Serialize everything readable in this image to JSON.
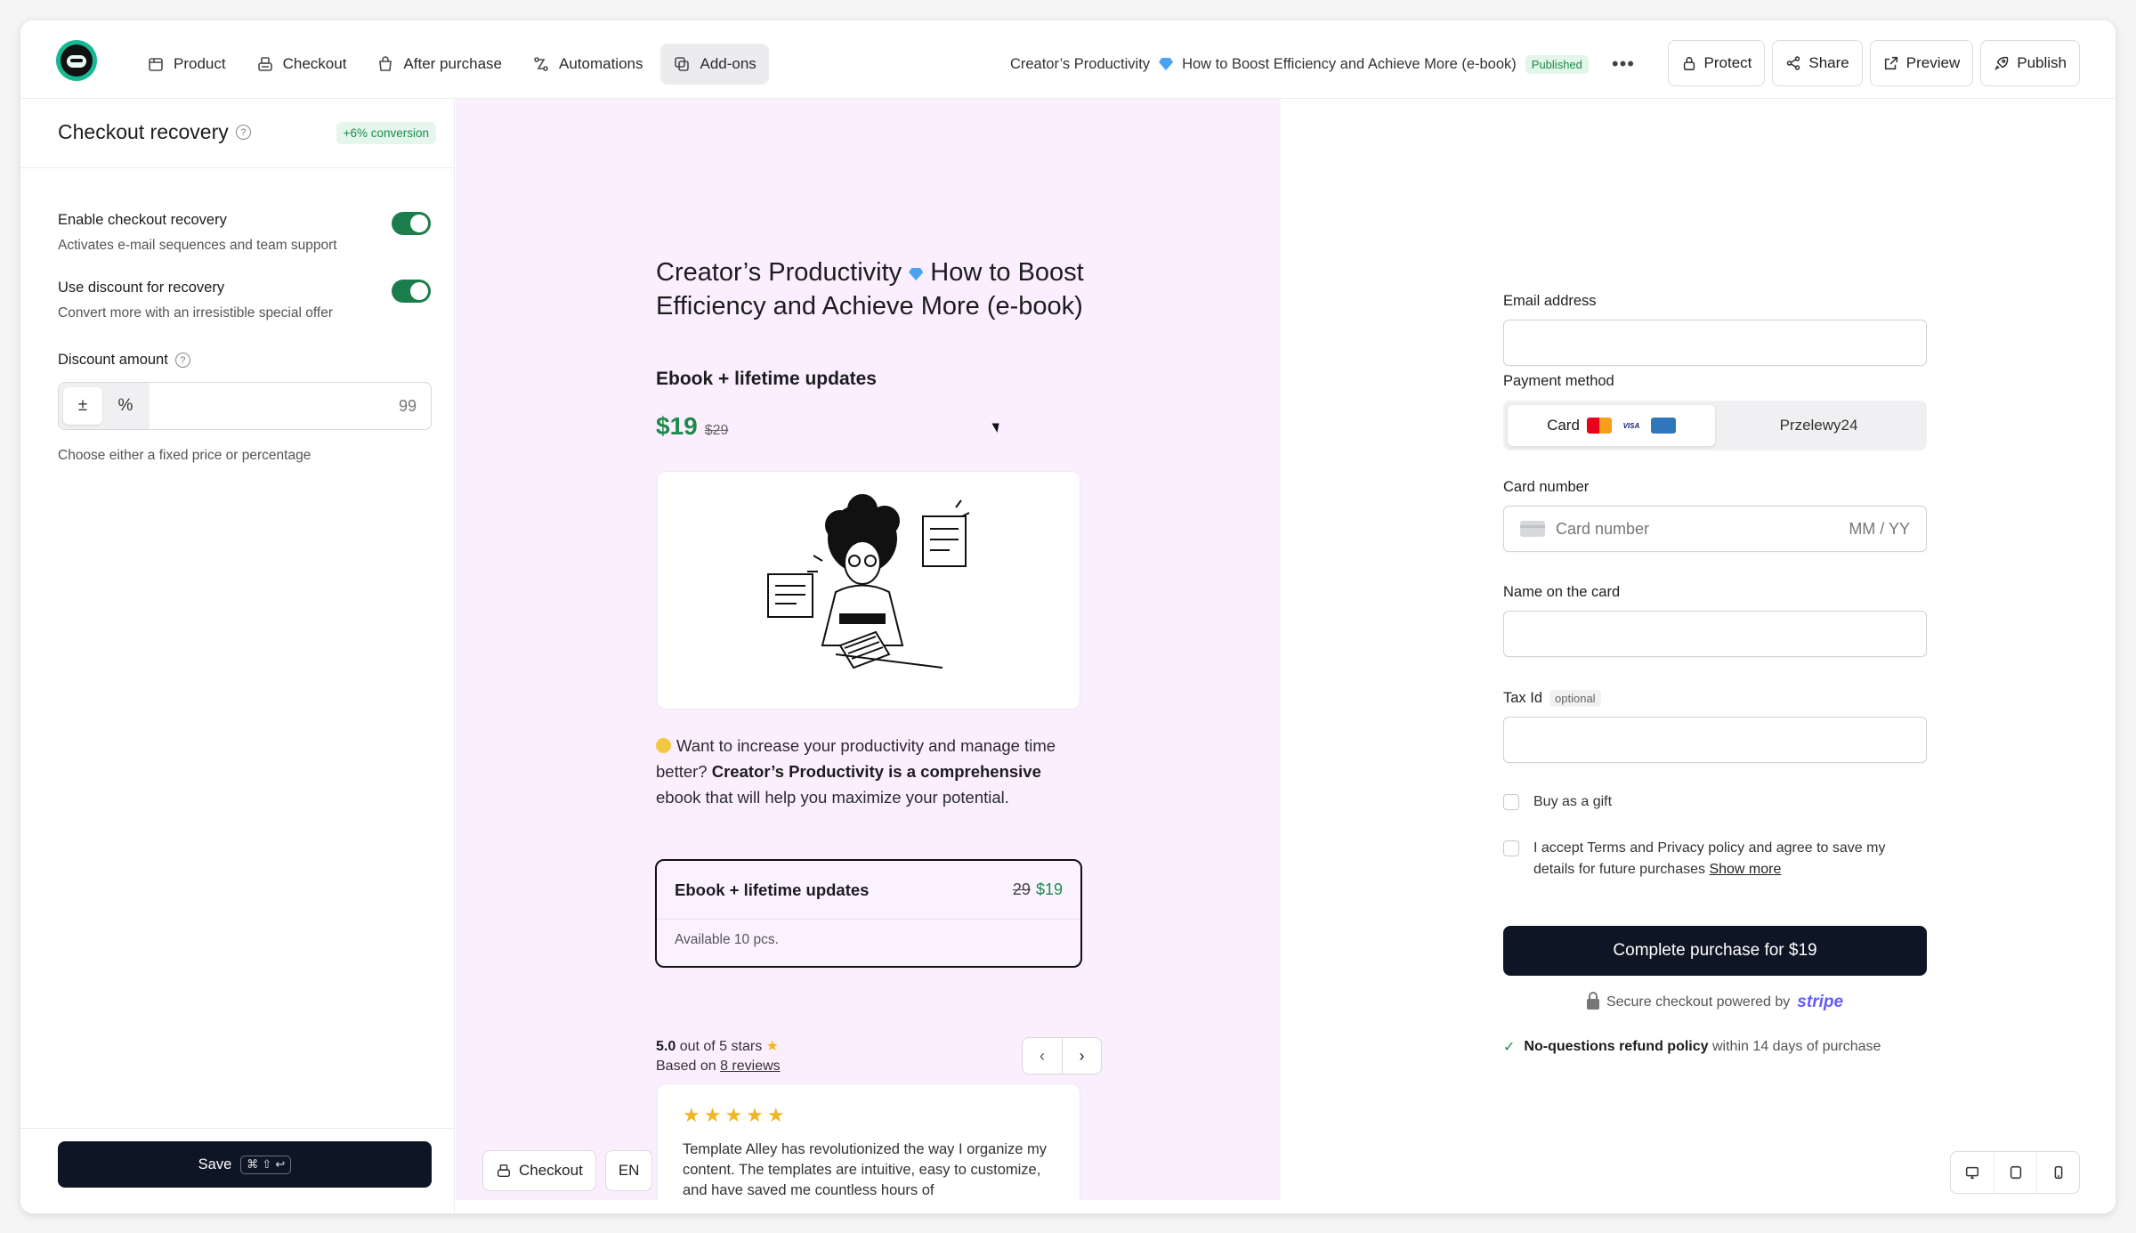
{
  "nav": {
    "items": [
      {
        "label": "Product",
        "icon": "package-icon"
      },
      {
        "label": "Checkout",
        "icon": "register-icon"
      },
      {
        "label": "After purchase",
        "icon": "bag-icon"
      },
      {
        "label": "Automations",
        "icon": "flow-icon"
      },
      {
        "label": "Add-ons",
        "icon": "addons-icon",
        "active": true
      }
    ]
  },
  "header": {
    "product_title_a": "Creator’s Productivity",
    "product_title_b": "How to Boost Efficiency and Achieve More (e-book)",
    "status": "Published",
    "more": "•••",
    "actions": {
      "protect": "Protect",
      "share": "Share",
      "preview": "Preview",
      "publish": "Publish"
    }
  },
  "left_panel": {
    "title": "Checkout recovery",
    "badge": "+6% conversion",
    "enable": {
      "label": "Enable checkout recovery",
      "desc": "Activates e-mail sequences and team support",
      "on": true
    },
    "discount_toggle": {
      "label": "Use discount for recovery",
      "desc": "Convert more with an irresistible special offer",
      "on": true
    },
    "discount_amount": {
      "label": "Discount amount",
      "fixed_symbol": "±",
      "percent_symbol": "%",
      "value": "99",
      "help": "Choose either a fixed price or percentage"
    },
    "save": {
      "label": "Save",
      "shortcut": "⌘ ⇧ ↩"
    }
  },
  "product": {
    "title_a": "Creator’s Productivity",
    "title_b": "How to Boost Efficiency and Achieve More (e-book)",
    "subtitle": "Ebook + lifetime updates",
    "price": "$19",
    "old_price": "$29",
    "pitch_a": "Want to increase your productivity and manage time better?",
    "pitch_b": "Creator’s Productivity is a comprehensive",
    "pitch_c": "ebook that will help you maximize your potential.",
    "variant": {
      "name": "Ebook + lifetime updates",
      "old": "29",
      "new": "$19",
      "stock": "Available 10 pcs."
    },
    "rating": {
      "score": "5.0",
      "text": "out of 5 stars",
      "based": "Based on",
      "reviews": "8 reviews"
    },
    "review": {
      "stars": "★★★★★",
      "text": "Template Alley has revolutionized the way I organize my content. The templates are intuitive, easy to customize, and have saved me countless hours of"
    },
    "floating": {
      "checkout": "Checkout",
      "lang": "EN"
    }
  },
  "checkout_form": {
    "email_label": "Email address",
    "payment_label": "Payment method",
    "pay_card": "Card",
    "pay_p24": "Przelewy24",
    "visa_text": "VISA",
    "card_label": "Card number",
    "card_placeholder": "Card number",
    "card_exp": "MM / YY",
    "name_label": "Name on the card",
    "tax_label": "Tax Id",
    "tax_optional": "optional",
    "gift": "Buy as a gift",
    "terms": "I accept Terms and Privacy policy and agree to save my details for future purchases",
    "show_more": "Show more",
    "complete": "Complete purchase for $19",
    "secure": "Secure checkout powered by",
    "stripe": "stripe",
    "refund_bold": "No-questions refund policy",
    "refund_rest": "within 14 days of purchase"
  },
  "colors": {
    "accent_green": "#1d8b4a",
    "dark": "#0e1525",
    "product_bg": "#fbefff",
    "stripe": "#635bff"
  }
}
